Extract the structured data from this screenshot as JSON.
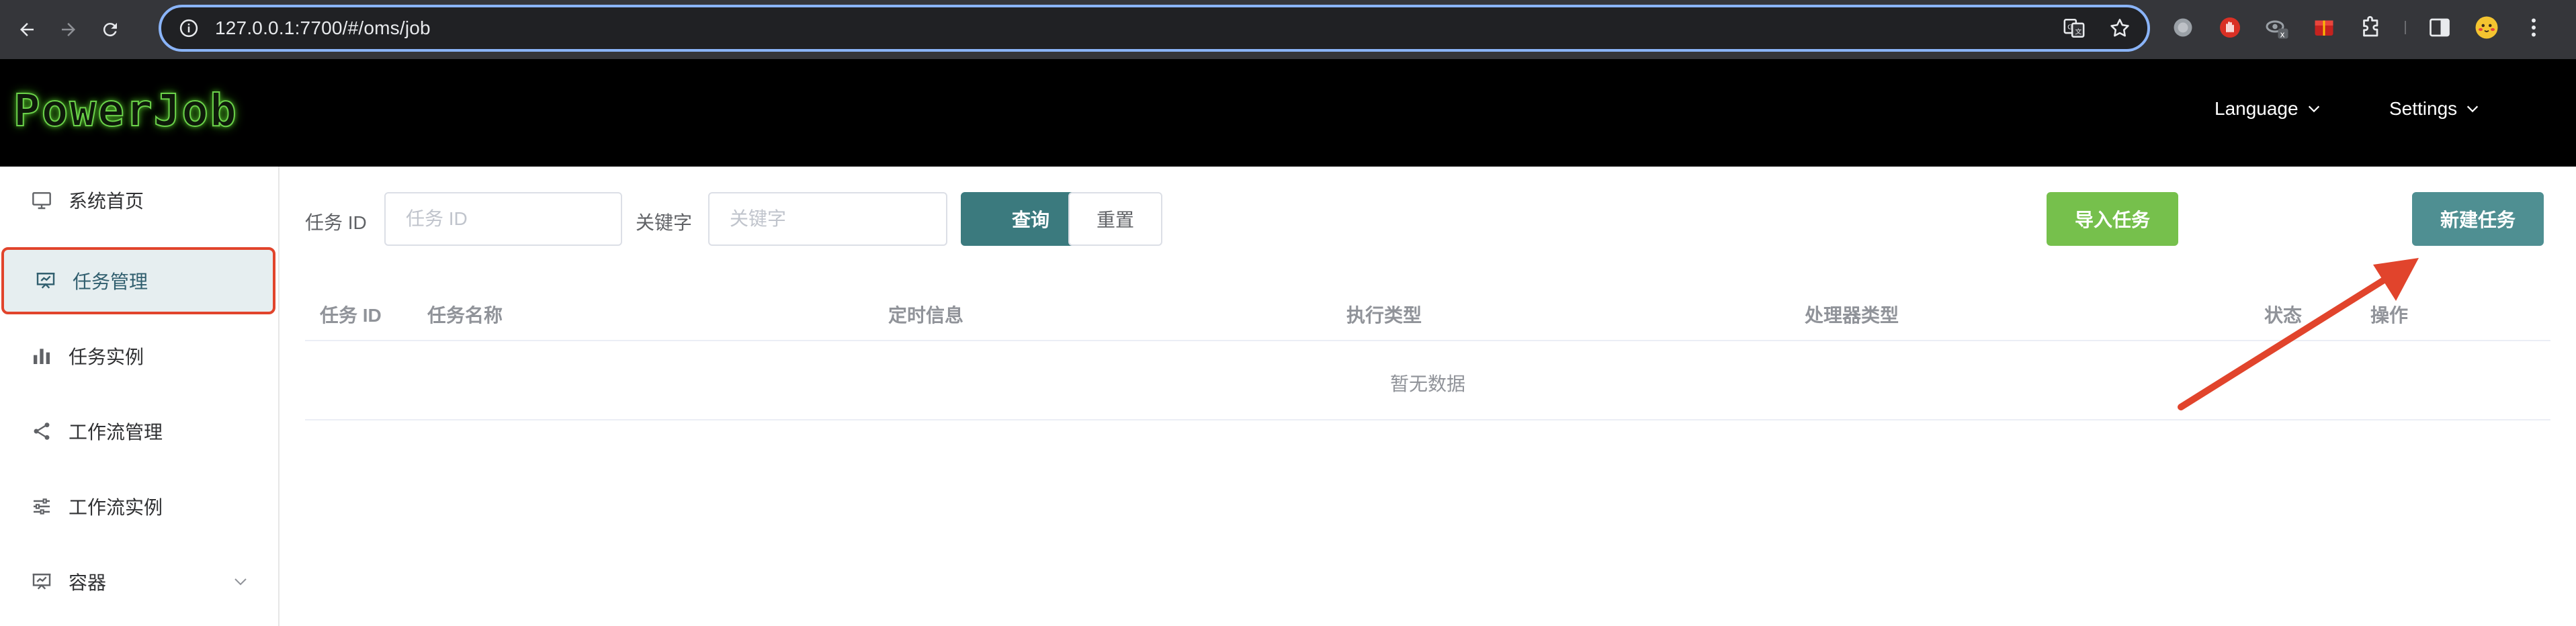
{
  "browser": {
    "url": "127.0.0.1:7700/#/oms/job"
  },
  "app": {
    "logo": "PowerJob",
    "header_menus": [
      "Language",
      "Settings"
    ]
  },
  "sidebar": {
    "items": [
      {
        "label": "系统首页",
        "icon": "monitor-icon"
      },
      {
        "label": "任务管理",
        "icon": "presentation-icon",
        "active": true
      },
      {
        "label": "任务实例",
        "icon": "bar-chart-icon"
      },
      {
        "label": "工作流管理",
        "icon": "share-icon"
      },
      {
        "label": "工作流实例",
        "icon": "sliders-icon"
      },
      {
        "label": "容器",
        "icon": "presentation-icon",
        "expandable": true
      }
    ]
  },
  "filters": {
    "job_id_label": "任务 ID",
    "job_id_placeholder": "任务 ID",
    "keyword_label": "关键字",
    "keyword_placeholder": "关键字",
    "query_button": "查询",
    "reset_button": "重置",
    "import_button": "导入任务",
    "new_button": "新建任务"
  },
  "table": {
    "columns": [
      "任务 ID",
      "任务名称",
      "定时信息",
      "执行类型",
      "处理器类型",
      "状态",
      "操作"
    ],
    "empty_text": "暂无数据"
  },
  "colors": {
    "accent": "#3b7a7e",
    "import": "#76c04c",
    "new": "#4f8f92",
    "annotation": "#e1442c"
  }
}
